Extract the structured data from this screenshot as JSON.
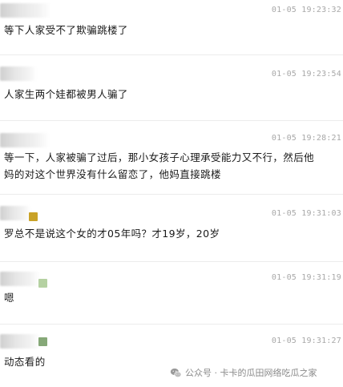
{
  "comments": [
    {
      "timestamp": "01-05 19:23:32",
      "text": "等下人家受不了欺骗跳楼了"
    },
    {
      "timestamp": "01-05 19:23:54",
      "text": "人家生两个娃都被男人骗了"
    },
    {
      "timestamp": "01-05 19:28:21",
      "text": "等一下，人家被骗了过后，那小女孩子心理承受能力又不行，然后他妈的对这个世界没有什么留恋了，他妈直接跳楼"
    },
    {
      "timestamp": "01-05 19:31:03",
      "text": "罗总不是说这个女的才05年吗？才19岁，20岁"
    },
    {
      "timestamp": "01-05 19:31:19",
      "text": "嗯"
    },
    {
      "timestamp": "01-05 19:31:27",
      "text": "动态看的"
    }
  ],
  "avatar_colors": {
    "c3": "#c9a227",
    "c4": "#b5d1a2",
    "c5": "#86a878"
  },
  "watermark": {
    "icon": "wechat-icon",
    "text": "公众号 · 卡卡的瓜田网络吃瓜之家"
  }
}
